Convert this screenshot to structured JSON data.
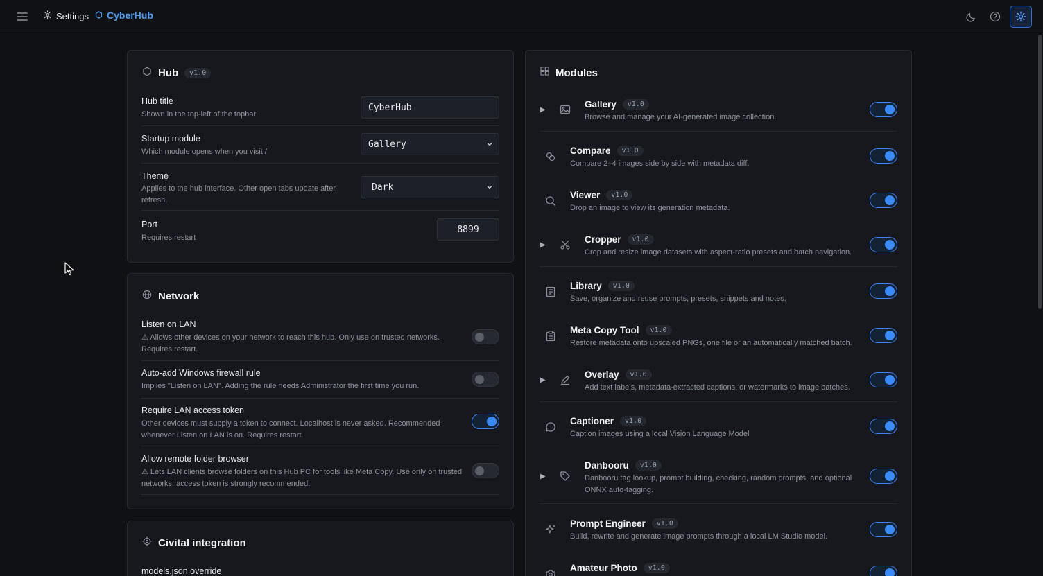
{
  "topbar": {
    "settings_label": "Settings",
    "brand_name": "CyberHub",
    "icons": [
      "menu-icon",
      "gear-icon",
      "hexagon-icon",
      "moon-icon",
      "help-icon",
      "settings-icon"
    ]
  },
  "hub": {
    "title": "Hub",
    "version": "v1.0",
    "rows": [
      {
        "label": "Hub title",
        "desc": "Shown in the top-left of the topbar",
        "value": "CyberHub"
      },
      {
        "label": "Startup module",
        "desc": "Which module opens when you visit /",
        "value": "Gallery"
      },
      {
        "label": "Theme",
        "desc": "Applies to the hub interface. Other open tabs update after refresh.",
        "value": "Dark"
      },
      {
        "label": "Port",
        "desc": "Requires restart",
        "value": "8899"
      }
    ]
  },
  "network": {
    "title": "Network",
    "rows": [
      {
        "label": "Listen on LAN",
        "desc": "⚠ Allows other devices on your network to reach this hub. Only use on trusted networks. Requires restart.",
        "enabled": false
      },
      {
        "label": "Auto-add Windows firewall rule",
        "desc": "Implies \"Listen on LAN\". Adding the rule needs Administrator the first time you run.",
        "enabled": false
      },
      {
        "label": "Require LAN access token",
        "desc": "Other devices must supply a token to connect. Localhost is never asked. Recommended whenever Listen on LAN is on. Requires restart.",
        "enabled": true
      },
      {
        "label": "Allow remote folder browser",
        "desc": "⚠ Lets LAN clients browse folders on this Hub PC for tools like Meta Copy. Use only on trusted networks; access token is strongly recommended.",
        "enabled": false
      }
    ]
  },
  "civitai": {
    "title": "Civital integration",
    "first_row_label": "models.json override"
  },
  "modules": {
    "title": "Modules",
    "items": [
      {
        "name": "Gallery",
        "version": "v1.0",
        "desc": "Browse and manage your AI-generated image collection.",
        "expandable": true,
        "icon": "image-icon",
        "enabled": true
      },
      {
        "name": "Compare",
        "version": "v1.0",
        "desc": "Compare 2–4 images side by side with metadata diff.",
        "expandable": false,
        "icon": "compare-icon",
        "enabled": true
      },
      {
        "name": "Viewer",
        "version": "v1.0",
        "desc": "Drop an image to view its generation metadata.",
        "expandable": false,
        "icon": "search-icon",
        "enabled": true
      },
      {
        "name": "Cropper",
        "version": "v1.0",
        "desc": "Crop and resize image datasets with aspect-ratio presets and batch navigation.",
        "expandable": true,
        "icon": "scissors-icon",
        "enabled": true
      },
      {
        "name": "Library",
        "version": "v1.0",
        "desc": "Save, organize and reuse prompts, presets, snippets and notes.",
        "expandable": false,
        "icon": "document-icon",
        "enabled": true
      },
      {
        "name": "Meta Copy Tool",
        "version": "v1.0",
        "desc": "Restore metadata onto upscaled PNGs, one file or an automatically matched batch.",
        "expandable": false,
        "icon": "clipboard-icon",
        "enabled": true
      },
      {
        "name": "Overlay",
        "version": "v1.0",
        "desc": "Add text labels, metadata-extracted captions, or watermarks to image batches.",
        "expandable": true,
        "icon": "pen-icon",
        "enabled": true
      },
      {
        "name": "Captioner",
        "version": "v1.0",
        "desc": "Caption images using a local Vision Language Model",
        "expandable": false,
        "icon": "chat-icon",
        "enabled": true
      },
      {
        "name": "Danbooru",
        "version": "v1.0",
        "desc": "Danbooru tag lookup, prompt building, checking, random prompts, and optional ONNX auto-tagging.",
        "expandable": true,
        "icon": "tag-icon",
        "enabled": true
      },
      {
        "name": "Prompt Engineer",
        "version": "v1.0",
        "desc": "Build, rewrite and generate image prompts through a local LM Studio model.",
        "expandable": false,
        "icon": "sparkle-icon",
        "enabled": true
      },
      {
        "name": "Amateur Photo",
        "version": "v1.0",
        "desc": "",
        "expandable": false,
        "icon": "camera-icon",
        "enabled": true
      }
    ]
  }
}
